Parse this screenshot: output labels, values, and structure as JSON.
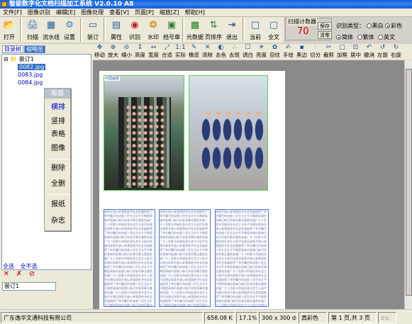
{
  "window": {
    "title": "智能数字化文档扫描加工系统 V2.0.10 A8"
  },
  "menu": [
    "文件[F]",
    "图像识别",
    "编辑[E]",
    "图像处理",
    "查看[V]",
    "页面[P]",
    "缩放[Z]",
    "帮助[H]"
  ],
  "toolbar": [
    {
      "icon": "open-icon",
      "glyph": "📂",
      "label": "打开"
    },
    {
      "icon": "scan-icon",
      "glyph": "🖨",
      "label": "扫描"
    },
    {
      "icon": "pipeline-icon",
      "glyph": "▦",
      "label": "流水线"
    },
    {
      "icon": "settings-icon",
      "glyph": "⚙",
      "label": "设置"
    },
    {
      "icon": "bind-icon",
      "glyph": "▭",
      "label": "装订"
    },
    {
      "icon": "properties-icon",
      "glyph": "▤",
      "label": "属性"
    },
    {
      "icon": "recognize-icon",
      "glyph": "◉",
      "label": "识别"
    },
    {
      "icon": "watermark-icon",
      "glyph": "❂",
      "label": "水印"
    },
    {
      "icon": "stamp-icon",
      "glyph": "▣",
      "label": "档号章"
    },
    {
      "icon": "elements-icon",
      "glyph": "▩",
      "label": "元数据"
    },
    {
      "icon": "page-sort-icon",
      "glyph": "⇅",
      "label": "页排序"
    },
    {
      "icon": "exit-icon",
      "glyph": "⇥",
      "label": "退出"
    },
    {
      "icon": "current-icon",
      "glyph": "□",
      "label": "当前"
    },
    {
      "icon": "fullpage-icon",
      "glyph": "▢",
      "label": "全文"
    }
  ],
  "scan_counter": {
    "caption": "扫描计数器",
    "value": "70",
    "save_label": "保存",
    "clear_label": "清零"
  },
  "recognition": {
    "type_label": "识别类型：",
    "color_options": [
      "黑白",
      "彩色"
    ],
    "color_selected": "彩色",
    "script_options": [
      "简体",
      "繁体",
      "英文"
    ],
    "script_selected": "简体"
  },
  "left_tabs": [
    "目录树",
    "缩略图"
  ],
  "tree": {
    "root": "装订1",
    "files": [
      "0082.jpg",
      "0083.jpg",
      "0084.jpg"
    ]
  },
  "layout_panel": {
    "title": "版面",
    "buttons": [
      "横排",
      "竖排",
      "表格",
      "图像",
      "删除",
      "全删",
      "报纸",
      "杂志"
    ]
  },
  "selection": {
    "all": "全选",
    "none": "全不选"
  },
  "bind_input_value": "装订1",
  "image_toolbar": [
    "移动",
    "放大",
    "缩小",
    "高度",
    "宽度",
    "合适",
    "实际",
    "橡皮",
    "清除",
    "去色",
    "去斑",
    "调白",
    "亮度",
    "自纹",
    "手绘",
    "黑边",
    "切分",
    "裁剪",
    "加框",
    "居中",
    "撤消",
    "左旋",
    "右旋"
  ],
  "status": {
    "company": "广东逸华文通科技有限公司",
    "size": "658.08 K",
    "zoom": "17.1%",
    "dpi": "300 x 300 dpi",
    "color": "真彩色",
    "page": "第 1 页,共 3 页",
    "mode": "Ins"
  },
  "document": {
    "header_tag": "中国画报",
    "text_sample": "改革开放以来我国经济社会发展取得了举世瞩目的成就人民生活水平不断提高城市面貌日新月异各项事业蓬勃发展广大人民群众积极投身社会主义现代化建设"
  }
}
